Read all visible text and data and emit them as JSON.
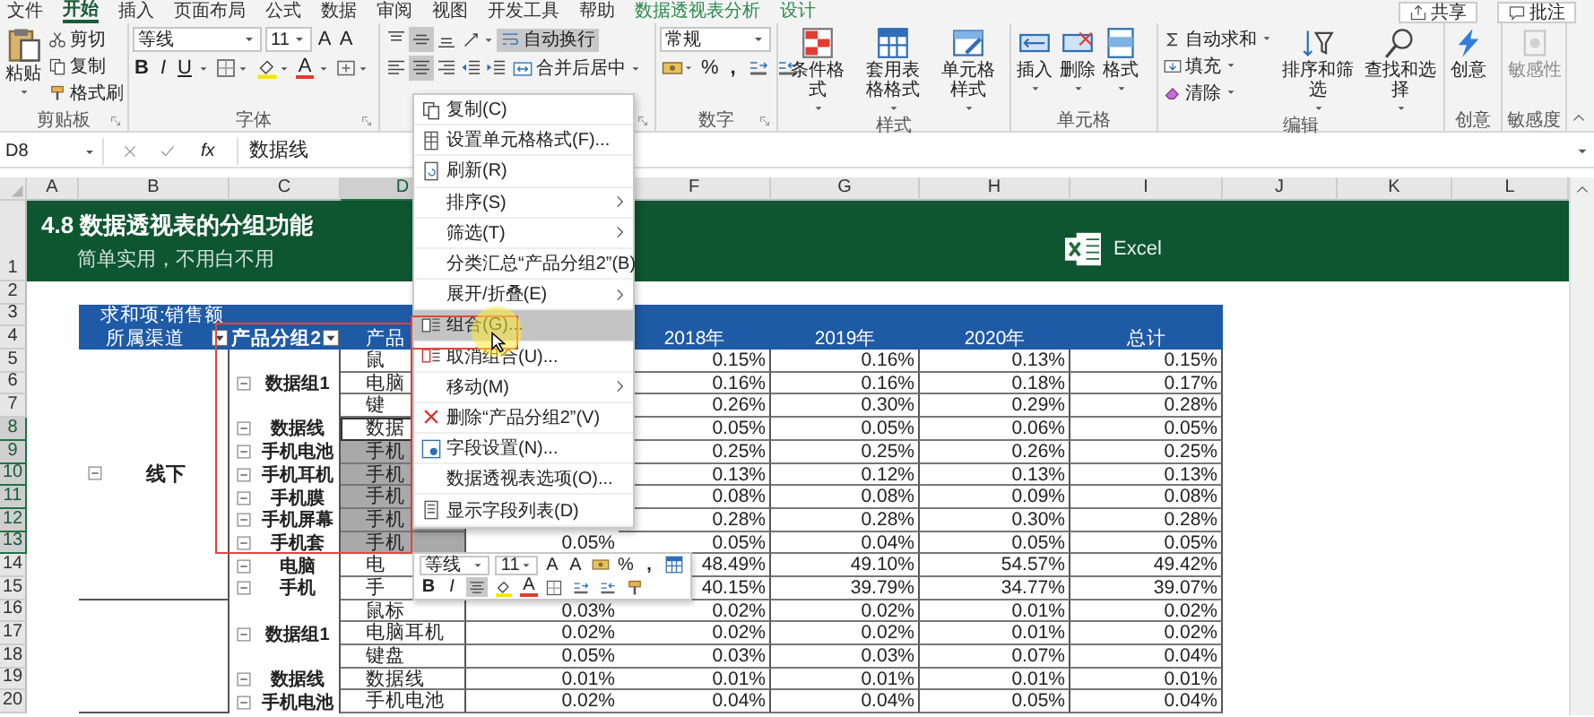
{
  "ribbon_tabs": [
    {
      "label": "文件",
      "selected": false,
      "kind": "normal"
    },
    {
      "label": "开始",
      "selected": true,
      "kind": "normal"
    },
    {
      "label": "插入",
      "selected": false,
      "kind": "normal"
    },
    {
      "label": "页面布局",
      "selected": false,
      "kind": "normal"
    },
    {
      "label": "公式",
      "selected": false,
      "kind": "normal"
    },
    {
      "label": "数据",
      "selected": false,
      "kind": "normal"
    },
    {
      "label": "审阅",
      "selected": false,
      "kind": "normal"
    },
    {
      "label": "视图",
      "selected": false,
      "kind": "normal"
    },
    {
      "label": "开发工具",
      "selected": false,
      "kind": "normal"
    },
    {
      "label": "帮助",
      "selected": false,
      "kind": "normal"
    },
    {
      "label": "数据透视表分析",
      "selected": false,
      "kind": "contextual"
    },
    {
      "label": "设计",
      "selected": false,
      "kind": "contextual"
    }
  ],
  "share_button": "共享",
  "comments_button": "批注",
  "clipboard": {
    "label": "剪贴板",
    "paste": "粘贴",
    "cut": "剪切",
    "copy": "复制",
    "format_painter": "格式刷"
  },
  "font": {
    "label": "字体",
    "font_name": "等线",
    "font_size": "11",
    "grow": "A",
    "shrink": "A",
    "bold": "B",
    "italic": "I",
    "underline": "U",
    "font_color": "A"
  },
  "alignment": {
    "middle_align_on": true,
    "center_on": true,
    "wrap_text": {
      "label": "自动换行",
      "on": true
    },
    "merge": "合并后居中"
  },
  "number": {
    "label": "数字",
    "format": "常规",
    "percent": "%",
    "comma": ","
  },
  "styles": {
    "label": "样式",
    "buttons": [
      "条件格式",
      "套用表格格式",
      "单元格样式"
    ]
  },
  "cells": {
    "label": "单元格",
    "buttons": [
      "插入",
      "删除",
      "格式"
    ]
  },
  "editing": {
    "label": "编辑",
    "autosum": "自动求和",
    "fill": "填充",
    "clear": "清除",
    "sort_filter": "排序和筛选",
    "find_select": "查找和选择"
  },
  "ideas": {
    "label": "创意",
    "button": "创意"
  },
  "sensitivity": {
    "label": "敏感度",
    "button": "敏感性",
    "disabled": true
  },
  "formula_bar": {
    "name_box": "D8",
    "function_button": "fx",
    "content": "数据线"
  },
  "columns": [
    {
      "label": "A",
      "selected": false
    },
    {
      "label": "B",
      "selected": false
    },
    {
      "label": "C",
      "selected": false
    },
    {
      "label": "D",
      "selected": true
    },
    {
      "label": "F",
      "selected": false
    },
    {
      "label": "G",
      "selected": false
    },
    {
      "label": "H",
      "selected": false
    },
    {
      "label": "I",
      "selected": false
    },
    {
      "label": "J",
      "selected": false
    },
    {
      "label": "K",
      "selected": false
    },
    {
      "label": "L",
      "selected": false
    }
  ],
  "row_numbers": [
    {
      "label": "1",
      "selected": false
    },
    {
      "label": "2",
      "selected": false
    },
    {
      "label": "3",
      "selected": false
    },
    {
      "label": "4",
      "selected": false
    },
    {
      "label": "5",
      "selected": false
    },
    {
      "label": "6",
      "selected": false
    },
    {
      "label": "7",
      "selected": false
    },
    {
      "label": "8",
      "selected": true
    },
    {
      "label": "9",
      "selected": true
    },
    {
      "label": "10",
      "selected": true
    },
    {
      "label": "11",
      "selected": true
    },
    {
      "label": "12",
      "selected": true
    },
    {
      "label": "13",
      "selected": true
    },
    {
      "label": "14",
      "selected": false
    },
    {
      "label": "15",
      "selected": false
    },
    {
      "label": "16",
      "selected": false
    },
    {
      "label": "17",
      "selected": false
    },
    {
      "label": "18",
      "selected": false
    },
    {
      "label": "19",
      "selected": false
    },
    {
      "label": "20",
      "selected": false
    }
  ],
  "banner": {
    "title": "4.8 数据透视表的分组功能",
    "subtitle": "简单实用，不用白不用",
    "logo_text": "Excel"
  },
  "pivot": {
    "value_field": "求和项:销售额",
    "channel_field": "所属渠道",
    "group_field": "产品分组2",
    "product_field": "产品",
    "year_headers": [
      "2018年",
      "2019年",
      "2020年",
      "总计"
    ],
    "channels": [
      {
        "name": "线下",
        "expanded": true,
        "groups": [
          {
            "name": "数据组1",
            "expanded": true,
            "items": [
              {
                "product": "鼠",
                "selected": false,
                "active": false,
                "values": [
                  "0.15%",
                  "0.16%",
                  "0.13%",
                  "0.15%"
                ]
              },
              {
                "product": "电脑",
                "selected": false,
                "active": false,
                "values": [
                  "0.16%",
                  "0.16%",
                  "0.18%",
                  "0.17%"
                ]
              },
              {
                "product": "键",
                "selected": false,
                "active": false,
                "values": [
                  "0.26%",
                  "0.30%",
                  "0.29%",
                  "0.28%"
                ]
              }
            ]
          },
          {
            "name": "数据线",
            "expanded": true,
            "items": [
              {
                "product": "数据",
                "selected": false,
                "active": true,
                "values": [
                  "0.05%",
                  "0.05%",
                  "0.06%",
                  "0.05%"
                ]
              }
            ]
          },
          {
            "name": "手机电池",
            "expanded": true,
            "items": [
              {
                "product": "手机",
                "selected": true,
                "active": false,
                "values": [
                  "0.25%",
                  "0.25%",
                  "0.26%",
                  "0.25%"
                ]
              }
            ]
          },
          {
            "name": "手机耳机",
            "expanded": true,
            "items": [
              {
                "product": "手机",
                "selected": true,
                "active": false,
                "values": [
                  "0.13%",
                  "0.12%",
                  "0.13%",
                  "0.13%"
                ]
              }
            ]
          },
          {
            "name": "手机膜",
            "expanded": true,
            "items": [
              {
                "product": "手机",
                "selected": true,
                "active": false,
                "values": [
                  "0.08%",
                  "0.08%",
                  "0.09%",
                  "0.08%"
                ]
              }
            ]
          },
          {
            "name": "手机屏幕",
            "expanded": true,
            "items": [
              {
                "product": "手机",
                "selected": true,
                "active": false,
                "values": [
                  "0.28%",
                  "0.28%",
                  "0.30%",
                  "0.28%"
                ]
              }
            ]
          },
          {
            "name": "手机套",
            "expanded": true,
            "items": [
              {
                "product": "手机",
                "selected": true,
                "active": false,
                "column_e": "0.05%",
                "values": [
                  "0.05%",
                  "0.04%",
                  "0.05%",
                  "0.05%"
                ]
              }
            ]
          },
          {
            "name": "电脑",
            "expanded": true,
            "items": [
              {
                "product": "电",
                "selected": false,
                "active": false,
                "values": [
                  "48.49%",
                  "49.10%",
                  "54.57%",
                  "49.42%"
                ]
              }
            ]
          },
          {
            "name": "手机",
            "expanded": true,
            "items": [
              {
                "product": "手",
                "selected": false,
                "active": false,
                "values": [
                  "40.15%",
                  "39.79%",
                  "34.77%",
                  "39.07%"
                ]
              }
            ]
          }
        ]
      },
      {
        "groups": [
          {
            "name": "数据组1",
            "expanded": true,
            "items": [
              {
                "product": "鼠标",
                "selected": false,
                "active": false,
                "column_e": "0.03%",
                "values": [
                  "0.02%",
                  "0.02%",
                  "0.01%",
                  "0.02%"
                ]
              },
              {
                "product": "电脑耳机",
                "selected": false,
                "active": false,
                "column_e": "0.02%",
                "values": [
                  "0.02%",
                  "0.02%",
                  "0.01%",
                  "0.02%"
                ]
              },
              {
                "product": "键盘",
                "selected": false,
                "active": false,
                "column_e": "0.05%",
                "values": [
                  "0.03%",
                  "0.03%",
                  "0.07%",
                  "0.04%"
                ]
              }
            ]
          },
          {
            "name": "数据线",
            "expanded": true,
            "items": [
              {
                "product": "数据线",
                "selected": false,
                "active": false,
                "column_e": "0.01%",
                "values": [
                  "0.01%",
                  "0.01%",
                  "0.01%",
                  "0.01%"
                ]
              }
            ]
          },
          {
            "name": "手机电池",
            "expanded": true,
            "items": [
              {
                "product": "手机电池",
                "selected": false,
                "active": false,
                "column_e": "0.02%",
                "values": [
                  "0.04%",
                  "0.04%",
                  "0.05%",
                  "0.04%"
                ]
              }
            ]
          }
        ]
      }
    ]
  },
  "context_menu": [
    {
      "label": "复制(C)",
      "kind": "command",
      "highlighted": false
    },
    {
      "label": "设置单元格格式(F)...",
      "kind": "command",
      "highlighted": false
    },
    {
      "label": "刷新(R)",
      "kind": "command",
      "highlighted": false
    },
    {
      "label": "排序(S)",
      "kind": "submenu",
      "highlighted": false
    },
    {
      "label": "筛选(T)",
      "kind": "submenu",
      "highlighted": false
    },
    {
      "label": "分类汇总“产品分组2”(B)",
      "kind": "command",
      "highlighted": false
    },
    {
      "label": "展开/折叠(E)",
      "kind": "submenu",
      "highlighted": false
    },
    {
      "label": "组合(G)...",
      "kind": "command",
      "highlighted": true
    },
    {
      "label": "取消组合(U)...",
      "kind": "command",
      "highlighted": false
    },
    {
      "label": "移动(M)",
      "kind": "submenu",
      "highlighted": false
    },
    {
      "label": "删除“产品分组2”(V)",
      "kind": "command",
      "highlighted": false
    },
    {
      "label": "字段设置(N)...",
      "kind": "command",
      "highlighted": false
    },
    {
      "label": "数据透视表选项(O)...",
      "kind": "command",
      "highlighted": false
    },
    {
      "label": "显示字段列表(D)",
      "kind": "command",
      "highlighted": false
    }
  ],
  "mini_toolbar": {
    "font_name": "等线",
    "font_size": "11",
    "grow": "A",
    "shrink": "A",
    "percent": "%",
    "comma": ",",
    "bold": "B",
    "italic": "I",
    "center_on": true,
    "font_color": "A"
  }
}
